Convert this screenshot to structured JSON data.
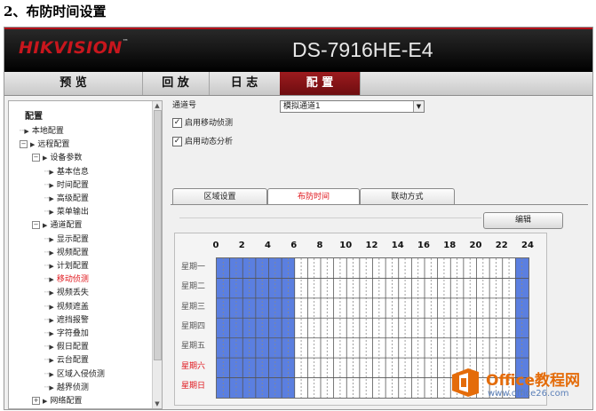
{
  "doc_heading": "2、布防时间设置",
  "app": {
    "brand": "HIKVISION",
    "model": "DS-7916HE-E4",
    "nav_tabs": [
      {
        "label": "预 览",
        "active": false
      },
      {
        "label": "回 放",
        "active": false
      },
      {
        "label": "日 志",
        "active": false
      },
      {
        "label": "配 置",
        "active": true
      }
    ]
  },
  "sidebar": {
    "title": "配置",
    "items": [
      {
        "label": "本地配置",
        "level": 1,
        "expander": "",
        "red": false
      },
      {
        "label": "远程配置",
        "level": 1,
        "expander": "−",
        "red": false
      },
      {
        "label": "设备参数",
        "level": 2,
        "expander": "−",
        "red": false
      },
      {
        "label": "基本信息",
        "level": 3,
        "expander": "",
        "red": false
      },
      {
        "label": "时间配置",
        "level": 3,
        "expander": "",
        "red": false
      },
      {
        "label": "高级配置",
        "level": 3,
        "expander": "",
        "red": false
      },
      {
        "label": "菜单输出",
        "level": 3,
        "expander": "",
        "red": false
      },
      {
        "label": "通道配置",
        "level": 2,
        "expander": "−",
        "red": false
      },
      {
        "label": "显示配置",
        "level": 3,
        "expander": "",
        "red": false
      },
      {
        "label": "视频配置",
        "level": 3,
        "expander": "",
        "red": false
      },
      {
        "label": "计划配置",
        "level": 3,
        "expander": "",
        "red": false
      },
      {
        "label": "移动侦测",
        "level": 3,
        "expander": "",
        "red": true
      },
      {
        "label": "视频丢失",
        "level": 3,
        "expander": "",
        "red": false
      },
      {
        "label": "视频遮盖",
        "level": 3,
        "expander": "",
        "red": false
      },
      {
        "label": "遮挡报警",
        "level": 3,
        "expander": "",
        "red": false
      },
      {
        "label": "字符叠加",
        "level": 3,
        "expander": "",
        "red": false
      },
      {
        "label": "假日配置",
        "level": 3,
        "expander": "",
        "red": false
      },
      {
        "label": "云台配置",
        "level": 3,
        "expander": "",
        "red": false
      },
      {
        "label": "区域入侵侦测",
        "level": 3,
        "expander": "",
        "red": false
      },
      {
        "label": "越界侦测",
        "level": 3,
        "expander": "",
        "red": false
      },
      {
        "label": "网络配置",
        "level": 2,
        "expander": "+",
        "red": false
      }
    ]
  },
  "content": {
    "channel_label": "通道号",
    "channel_value": "模拟通道1",
    "checks": [
      {
        "label": "启用移动侦测",
        "checked": true
      },
      {
        "label": "启用动态分析",
        "checked": true
      }
    ],
    "subtabs": [
      {
        "label": "区域设置",
        "active": false
      },
      {
        "label": "布防时间",
        "active": true
      },
      {
        "label": "联动方式",
        "active": false
      }
    ],
    "edit_button": "编辑",
    "hour_labels": [
      "0",
      "2",
      "4",
      "6",
      "8",
      "10",
      "12",
      "14",
      "16",
      "18",
      "20",
      "22",
      "24"
    ],
    "days": [
      {
        "label": "星期一",
        "red": false
      },
      {
        "label": "星期二",
        "red": false
      },
      {
        "label": "星期三",
        "red": false
      },
      {
        "label": "星期四",
        "red": false
      },
      {
        "label": "星期五",
        "red": false
      },
      {
        "label": "星期六",
        "red": true
      },
      {
        "label": "星期日",
        "red": true
      }
    ],
    "armed_ranges_hours": [
      [
        0,
        6
      ],
      [
        23,
        24
      ]
    ],
    "armed_color": "#5b7fe0"
  },
  "watermark": {
    "title": "Office教程网",
    "url": "www.office26.com",
    "logo_color": "#e46c0a"
  }
}
